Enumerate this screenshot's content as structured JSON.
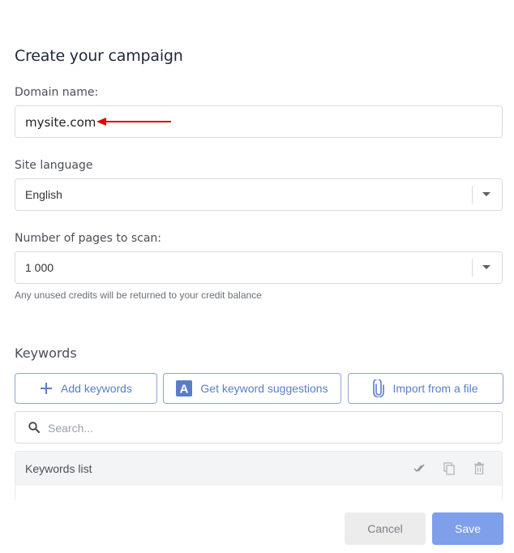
{
  "form": {
    "title": "Create your campaign",
    "domain_label": "Domain name:",
    "domain_value": "mysite.com",
    "language_label": "Site language",
    "language_value": "English",
    "pages_label": "Number of pages to scan:",
    "pages_value": "1 000",
    "pages_hint": "Any unused credits will be returned to your credit balance"
  },
  "keywords": {
    "section_title": "Keywords",
    "add_label": "Add keywords",
    "suggest_label": "Get keyword suggestions",
    "import_label": "Import from a file",
    "search_placeholder": "Search...",
    "list_title": "Keywords list"
  },
  "actions": {
    "cancel_label": "Cancel",
    "save_label": "Save"
  },
  "colors": {
    "accent": "#5b7dc8",
    "save_bg": "#7e9fe9",
    "annotation_arrow": "#e00000"
  }
}
